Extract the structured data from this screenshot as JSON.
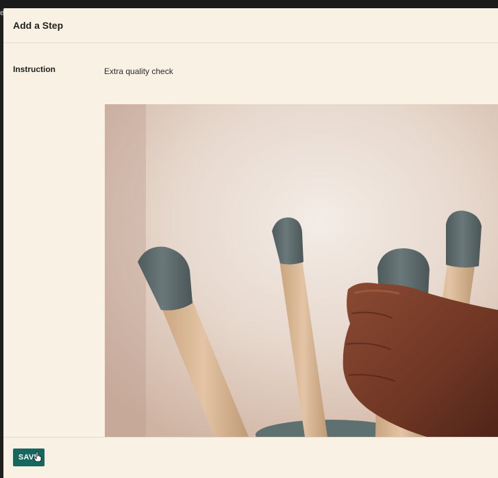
{
  "backdrop": {
    "clipped_char": "e"
  },
  "dialog": {
    "title": "Add a Step",
    "instruction": {
      "label": "Instruction",
      "value": "Extra quality check"
    },
    "media": {
      "alt": "Hand gripping one of four wooden stool legs with grey-capped tips"
    },
    "footer": {
      "save_label": "SAVE"
    }
  },
  "colors": {
    "dialog_background": "#f9f2e4",
    "primary_button": "#17675f",
    "leg_cap": "#5c6a6b",
    "leg_wood": "#dab99a"
  },
  "icons": {
    "cursor": "hand-pointer-icon"
  }
}
